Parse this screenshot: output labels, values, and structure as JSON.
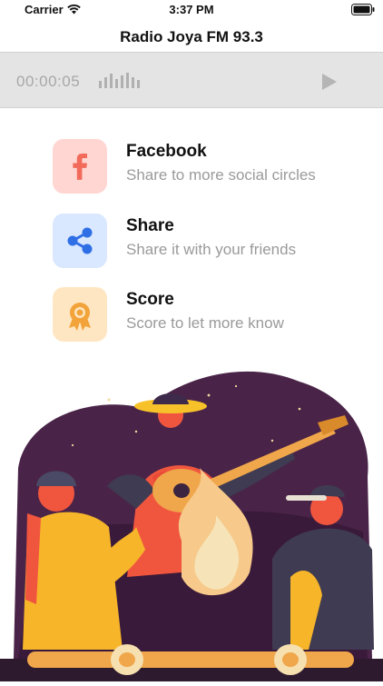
{
  "status_bar": {
    "carrier": "Carrier",
    "time": "3:37 PM"
  },
  "nav": {
    "title": "Radio Joya FM 93.3"
  },
  "player": {
    "elapsed": "00:00:05",
    "play_icon": "play-icon"
  },
  "colors": {
    "facebook_bg": "#ffd6d1",
    "facebook_fg": "#f26a5a",
    "share_bg": "#d9e7ff",
    "share_fg": "#2f6fe6",
    "score_bg": "#ffe6c2",
    "score_fg": "#f2a33a"
  },
  "menu": [
    {
      "icon": "facebook-icon",
      "label": "Facebook",
      "sub": "Share to more social circles"
    },
    {
      "icon": "share-icon",
      "label": "Share",
      "sub": "Share it with your friends"
    },
    {
      "icon": "award-icon",
      "label": "Score",
      "sub": "Score to let more know"
    }
  ]
}
